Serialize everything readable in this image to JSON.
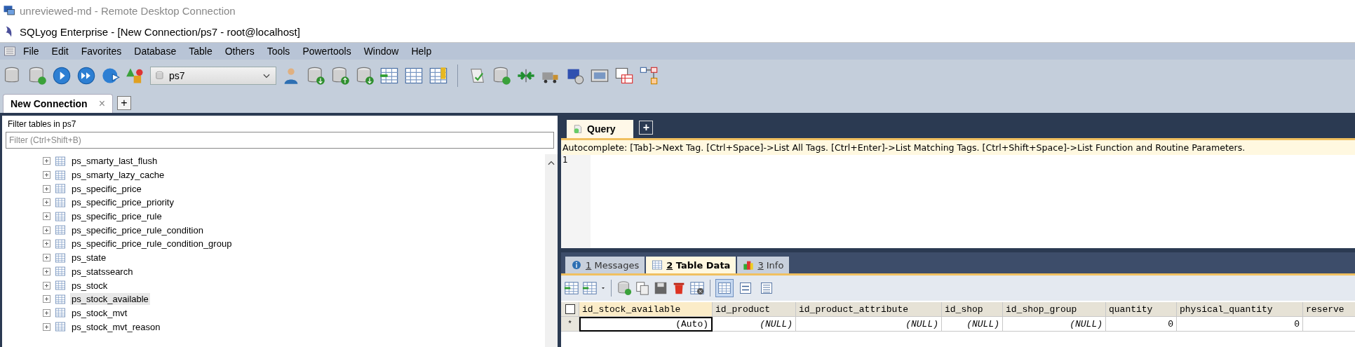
{
  "remote_window": {
    "title": "unreviewed-md - Remote Desktop Connection"
  },
  "window": {
    "title": "SQLyog Enterprise - [New Connection/ps7 - root@localhost]"
  },
  "menu": [
    "File",
    "Edit",
    "Favorites",
    "Database",
    "Table",
    "Others",
    "Tools",
    "Powertools",
    "Window",
    "Help"
  ],
  "database_selector": {
    "value": "ps7"
  },
  "connection_tabs": [
    {
      "label": "New Connection",
      "selected": true,
      "close": "×"
    }
  ],
  "new_tab_button": "+",
  "object_browser": {
    "title": "Filter tables in ps7",
    "filter": {
      "placeholder": "Filter (Ctrl+Shift+B)"
    },
    "tables": [
      {
        "name": "ps_smarty_last_flush",
        "selected": false
      },
      {
        "name": "ps_smarty_lazy_cache",
        "selected": false
      },
      {
        "name": "ps_specific_price",
        "selected": false
      },
      {
        "name": "ps_specific_price_priority",
        "selected": false
      },
      {
        "name": "ps_specific_price_rule",
        "selected": false
      },
      {
        "name": "ps_specific_price_rule_condition",
        "selected": false
      },
      {
        "name": "ps_specific_price_rule_condition_group",
        "selected": false
      },
      {
        "name": "ps_state",
        "selected": false
      },
      {
        "name": "ps_statssearch",
        "selected": false
      },
      {
        "name": "ps_stock",
        "selected": false
      },
      {
        "name": "ps_stock_available",
        "selected": true
      },
      {
        "name": "ps_stock_mvt",
        "selected": false
      },
      {
        "name": "ps_stock_mvt_reason",
        "selected": false
      }
    ]
  },
  "query_tabs": [
    {
      "label": "Query",
      "selected": true
    }
  ],
  "query_new_tab": "+",
  "autocomplete_hint": "Autocomplete: [Tab]->Next Tag. [Ctrl+Space]->List All Tags. [Ctrl+Enter]->List Matching Tags. [Ctrl+Shift+Space]->List Function and Routine Parameters.",
  "editor": {
    "line_numbers": [
      "1"
    ]
  },
  "result_tabs": [
    {
      "hotkey": "1",
      "label": "Messages",
      "selected": false,
      "kind": "messages"
    },
    {
      "hotkey": "2",
      "label": "Table Data",
      "selected": true,
      "kind": "table"
    },
    {
      "hotkey": "3",
      "label": "Info",
      "selected": false,
      "kind": "info"
    }
  ],
  "view_buttons": [
    {
      "kind": "grid",
      "selected": true
    },
    {
      "kind": "form",
      "selected": false
    },
    {
      "kind": "text",
      "selected": false
    }
  ],
  "table": {
    "select_all": {
      "checked": false
    },
    "columns": [
      "id_stock_available",
      "id_product",
      "id_product_attribute",
      "id_shop",
      "id_shop_group",
      "quantity",
      "physical_quantity",
      "reserve"
    ],
    "rows": [
      {
        "marker": "*",
        "cells": [
          {
            "text": "(Auto)",
            "kind": "auto",
            "selected": true
          },
          {
            "text": "(NULL)",
            "kind": "null",
            "selected": false
          },
          {
            "text": "(NULL)",
            "kind": "null",
            "selected": false
          },
          {
            "text": "(NULL)",
            "kind": "null",
            "selected": false
          },
          {
            "text": "(NULL)",
            "kind": "null",
            "selected": false
          },
          {
            "text": "0",
            "kind": "number",
            "selected": false
          },
          {
            "text": "0",
            "kind": "number",
            "selected": false
          }
        ]
      }
    ]
  }
}
